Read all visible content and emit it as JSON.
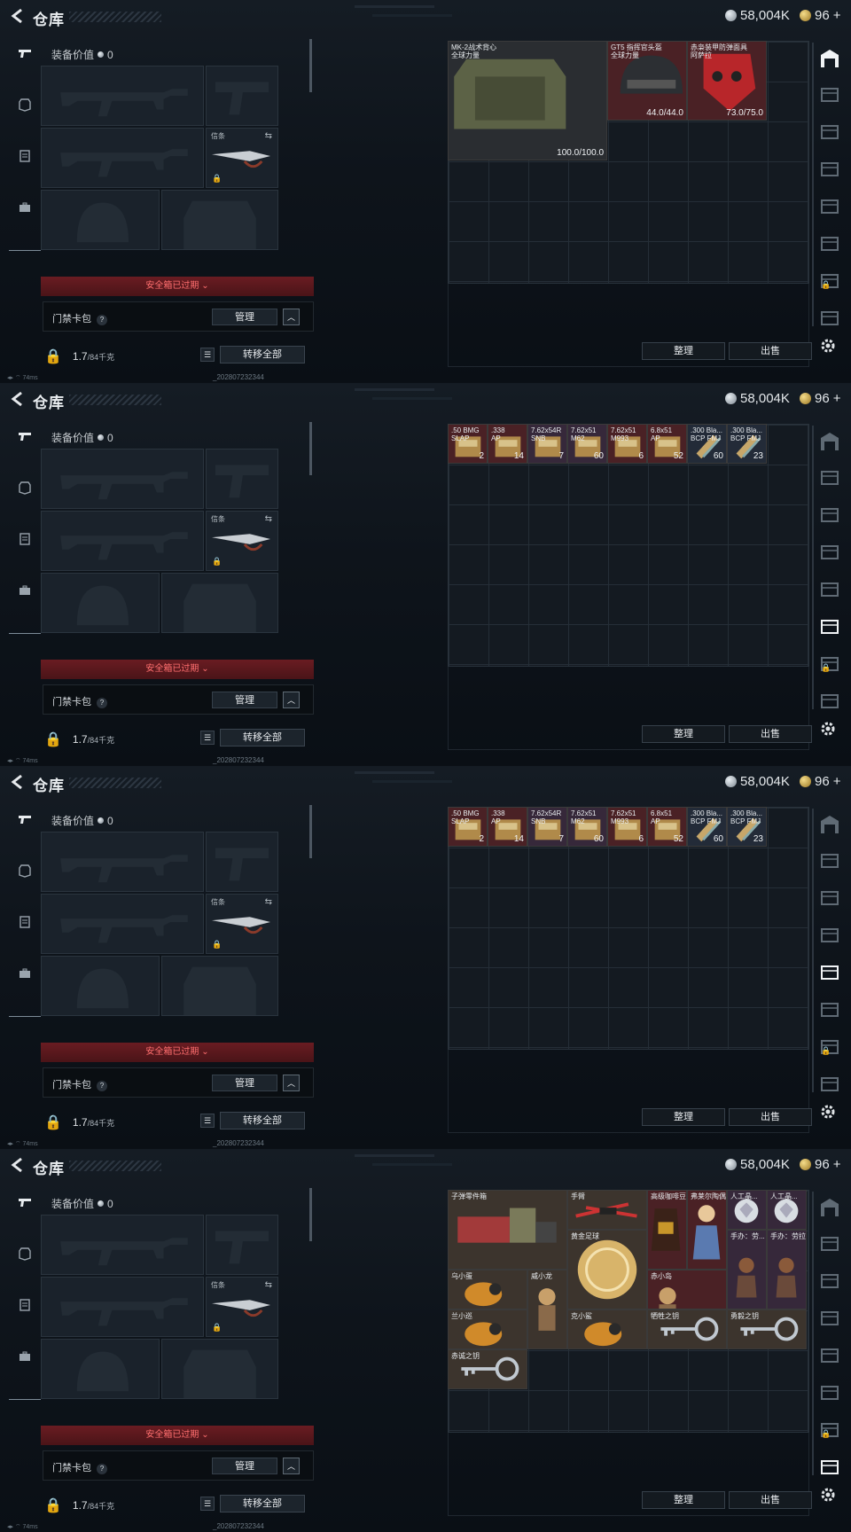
{
  "title": "仓库",
  "currency": {
    "silver": "58,004K",
    "gold": "96"
  },
  "left_panel": {
    "equip_value_label": "装备价值",
    "equip_value": "0",
    "melee_label": "信条",
    "safebox_warning": "安全箱已过期",
    "card_pack_label": "门禁卡包",
    "help": "?",
    "manage_label": "管理",
    "weight_value": "1.7",
    "weight_capacity": "/84千克",
    "transfer_all_label": "转移全部"
  },
  "status": {
    "ping": "74ms",
    "build": "_202807232344"
  },
  "buttons": {
    "sort": "整理",
    "sell": "出售"
  },
  "frames": [
    {
      "active_tab": 0,
      "items": [
        {
          "name": "MK-2战术背心\n全球力量",
          "qty": "100.0/100.0",
          "bg": "bg-grey",
          "icon": "vest-icon",
          "col": 0,
          "row": 0,
          "w": 4,
          "h": 3
        },
        {
          "name": "GT5 指挥官头盔\n全球力量",
          "qty": "44.0/44.0",
          "bg": "bg-red",
          "icon": "helmet-icon",
          "col": 4,
          "row": 0,
          "w": 2,
          "h": 2
        },
        {
          "name": "赤枭装甲防弹面具\n阿萨拉",
          "qty": "73.0/75.0",
          "bg": "bg-red",
          "icon": "mask-icon",
          "col": 6,
          "row": 0,
          "w": 2,
          "h": 2
        }
      ]
    },
    {
      "active_tab": 5,
      "items": [
        {
          "name": ".50 BMG\nSLAP",
          "qty": "2",
          "bg": "bg-red",
          "icon": "ammo-box-icon",
          "col": 0,
          "row": 0,
          "w": 1,
          "h": 1
        },
        {
          "name": ".338\nAP",
          "qty": "14",
          "bg": "bg-red",
          "icon": "ammo-box-icon",
          "col": 1,
          "row": 0,
          "w": 1,
          "h": 1
        },
        {
          "name": "7.62x54R\nSNB",
          "qty": "7",
          "bg": "bg-purp",
          "icon": "ammo-box-icon",
          "col": 2,
          "row": 0,
          "w": 1,
          "h": 1
        },
        {
          "name": "7.62x51\nM62",
          "qty": "60",
          "bg": "bg-purp",
          "icon": "ammo-box-icon",
          "col": 3,
          "row": 0,
          "w": 1,
          "h": 1
        },
        {
          "name": "7.62x51\nM993",
          "qty": "6",
          "bg": "bg-red",
          "icon": "ammo-box-icon",
          "col": 4,
          "row": 0,
          "w": 1,
          "h": 1
        },
        {
          "name": "6.8x51\nAP",
          "qty": "52",
          "bg": "bg-red",
          "icon": "ammo-box-icon",
          "col": 5,
          "row": 0,
          "w": 1,
          "h": 1
        },
        {
          "name": ".300 Bla...\nBCP FMJ",
          "qty": "60",
          "bg": "bg-blue",
          "icon": "ammo-round-icon",
          "col": 6,
          "row": 0,
          "w": 1,
          "h": 1
        },
        {
          "name": ".300 Bla...\nBCP FMJ",
          "qty": "23",
          "bg": "bg-blue",
          "icon": "ammo-round-icon",
          "col": 7,
          "row": 0,
          "w": 1,
          "h": 1
        }
      ]
    },
    {
      "active_tab": 4,
      "items": [
        {
          "name": ".50 BMG\nSLAP",
          "qty": "2",
          "bg": "bg-red",
          "icon": "ammo-box-icon",
          "col": 0,
          "row": 0,
          "w": 1,
          "h": 1
        },
        {
          "name": ".338\nAP",
          "qty": "14",
          "bg": "bg-red",
          "icon": "ammo-box-icon",
          "col": 1,
          "row": 0,
          "w": 1,
          "h": 1
        },
        {
          "name": "7.62x54R\nSNB",
          "qty": "7",
          "bg": "bg-purp",
          "icon": "ammo-box-icon",
          "col": 2,
          "row": 0,
          "w": 1,
          "h": 1
        },
        {
          "name": "7.62x51\nM62",
          "qty": "60",
          "bg": "bg-purp",
          "icon": "ammo-box-icon",
          "col": 3,
          "row": 0,
          "w": 1,
          "h": 1
        },
        {
          "name": "7.62x51\nM993",
          "qty": "6",
          "bg": "bg-red",
          "icon": "ammo-box-icon",
          "col": 4,
          "row": 0,
          "w": 1,
          "h": 1
        },
        {
          "name": "6.8x51\nAP",
          "qty": "52",
          "bg": "bg-red",
          "icon": "ammo-box-icon",
          "col": 5,
          "row": 0,
          "w": 1,
          "h": 1
        },
        {
          "name": ".300 Bla...\nBCP FMJ",
          "qty": "60",
          "bg": "bg-blue",
          "icon": "ammo-round-icon",
          "col": 6,
          "row": 0,
          "w": 1,
          "h": 1
        },
        {
          "name": ".300 Bla...\nBCP FMJ",
          "qty": "23",
          "bg": "bg-blue",
          "icon": "ammo-round-icon",
          "col": 7,
          "row": 0,
          "w": 1,
          "h": 1
        }
      ]
    },
    {
      "active_tab": 7,
      "items": [
        {
          "name": "子弹零件箱",
          "qty": "",
          "bg": "bg-brown",
          "icon": "parts-crate-icon",
          "col": 0,
          "row": 0,
          "w": 3,
          "h": 2
        },
        {
          "name": "手臂",
          "qty": "",
          "bg": "bg-brown",
          "icon": "crossbow-arm-icon",
          "col": 3,
          "row": 0,
          "w": 2,
          "h": 1
        },
        {
          "name": "高级咖啡豆",
          "qty": "",
          "bg": "bg-red",
          "icon": "coffee-bag-icon",
          "col": 5,
          "row": 0,
          "w": 1,
          "h": 2
        },
        {
          "name": "弗莱尔陶偶",
          "qty": "",
          "bg": "bg-red",
          "icon": "figurine-icon",
          "col": 6,
          "row": 0,
          "w": 1,
          "h": 2
        },
        {
          "name": "人工晶...",
          "qty": "",
          "bg": "bg-purp",
          "icon": "crystal-icon",
          "col": 7,
          "row": 0,
          "w": 1,
          "h": 1
        },
        {
          "name": "人工晶...",
          "qty": "",
          "bg": "bg-purp",
          "icon": "crystal-icon",
          "col": 8,
          "row": 0,
          "w": 1,
          "h": 1
        },
        {
          "name": "黄金足球",
          "qty": "",
          "bg": "bg-brown",
          "icon": "gold-ball-icon",
          "col": 3,
          "row": 1,
          "w": 2,
          "h": 2
        },
        {
          "name": "手办：劳...",
          "qty": "",
          "bg": "bg-purp",
          "icon": "figure-icon",
          "col": 7,
          "row": 1,
          "w": 1,
          "h": 2
        },
        {
          "name": "手办：劳拉",
          "qty": "",
          "bg": "bg-purp",
          "icon": "figure-icon",
          "col": 8,
          "row": 1,
          "w": 1,
          "h": 2
        },
        {
          "name": "乌小蛋",
          "qty": "",
          "bg": "bg-brown",
          "icon": "toy-bird-icon",
          "col": 0,
          "row": 2,
          "w": 2,
          "h": 1
        },
        {
          "name": "威小龙",
          "qty": "",
          "bg": "bg-brown",
          "icon": "toy-figure-icon",
          "col": 2,
          "row": 2,
          "w": 1,
          "h": 2
        },
        {
          "name": "赤小岛",
          "qty": "",
          "bg": "bg-red",
          "icon": "toy-figure-icon",
          "col": 5,
          "row": 2,
          "w": 2,
          "h": 1
        },
        {
          "name": "兰小巡",
          "qty": "",
          "bg": "bg-brown",
          "icon": "toy-bird-icon",
          "col": 0,
          "row": 3,
          "w": 2,
          "h": 1
        },
        {
          "name": "克小鲨",
          "qty": "",
          "bg": "bg-brown",
          "icon": "toy-bird-icon",
          "col": 3,
          "row": 3,
          "w": 2,
          "h": 1
        },
        {
          "name": "牺牲之钥",
          "qty": "",
          "bg": "bg-brown",
          "icon": "key-icon",
          "col": 5,
          "row": 3,
          "w": 2,
          "h": 1
        },
        {
          "name": "勇毅之钥",
          "qty": "",
          "bg": "bg-brown",
          "icon": "key-icon",
          "col": 7,
          "row": 3,
          "w": 2,
          "h": 1
        },
        {
          "name": "赤诚之钥",
          "qty": "",
          "bg": "bg-brown",
          "icon": "key-icon",
          "col": 0,
          "row": 4,
          "w": 2,
          "h": 1
        }
      ]
    }
  ]
}
